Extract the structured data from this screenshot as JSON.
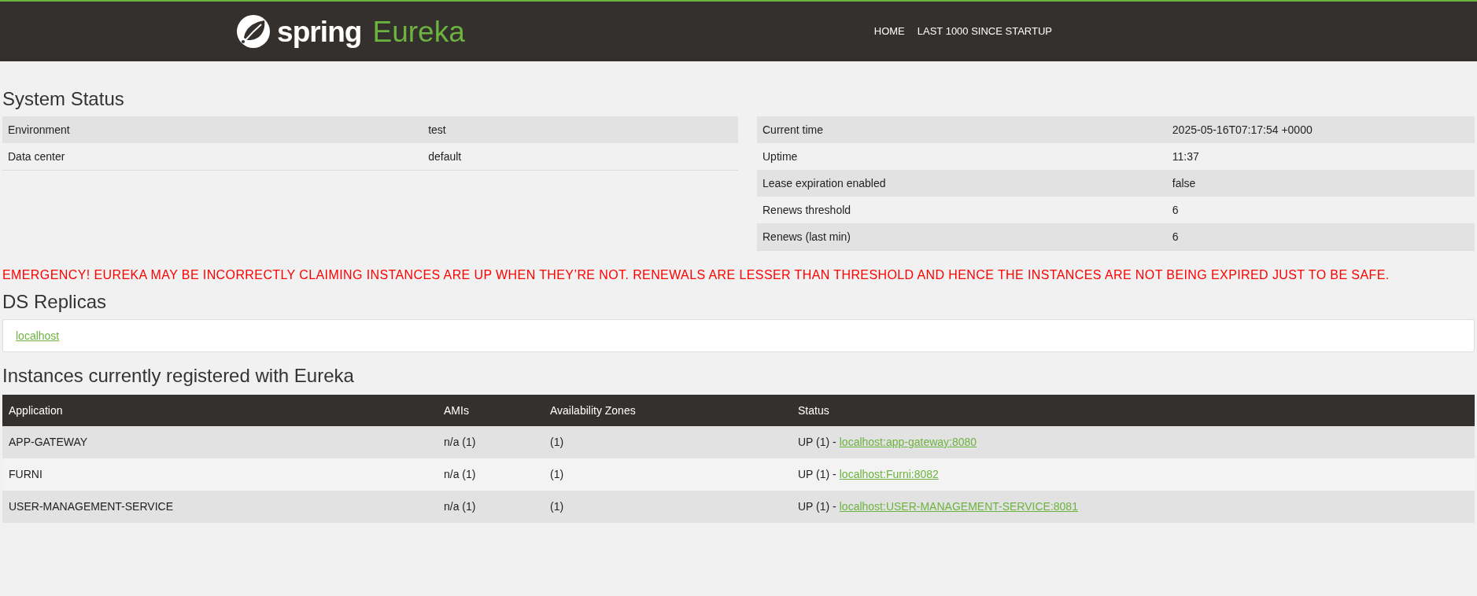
{
  "header": {
    "logo_word": "spring",
    "logo_product": "Eureka",
    "nav": [
      {
        "label": "HOME"
      },
      {
        "label": "LAST 1000 SINCE STARTUP"
      }
    ]
  },
  "system_status": {
    "title": "System Status",
    "left": [
      {
        "label": "Environment",
        "value": "test"
      },
      {
        "label": "Data center",
        "value": "default"
      }
    ],
    "right": [
      {
        "label": "Current time",
        "value": "2025-05-16T07:17:54 +0000"
      },
      {
        "label": "Uptime",
        "value": "11:37"
      },
      {
        "label": "Lease expiration enabled",
        "value": "false"
      },
      {
        "label": "Renews threshold",
        "value": "6"
      },
      {
        "label": "Renews (last min)",
        "value": "6"
      }
    ]
  },
  "emergency": "EMERGENCY! EUREKA MAY BE INCORRECTLY CLAIMING INSTANCES ARE UP WHEN THEY’RE NOT. RENEWALS ARE LESSER THAN THRESHOLD AND HENCE THE INSTANCES ARE NOT BEING EXPIRED JUST TO BE SAFE.",
  "ds_replicas": {
    "title": "DS Replicas",
    "items": [
      "localhost"
    ]
  },
  "instances": {
    "title": "Instances currently registered with Eureka",
    "columns": [
      "Application",
      "AMIs",
      "Availability Zones",
      "Status"
    ],
    "rows": [
      {
        "application": "APP-GATEWAY",
        "amis": "n/a (1)",
        "zones": "(1)",
        "status": "UP (1) -",
        "link": "localhost:app-gateway:8080"
      },
      {
        "application": "FURNI",
        "amis": "n/a (1)",
        "zones": "(1)",
        "status": "UP (1) -",
        "link": "localhost:Furni:8082"
      },
      {
        "application": "USER-MANAGEMENT-SERVICE",
        "amis": "n/a (1)",
        "zones": "(1)",
        "status": "UP (1) -",
        "link": "localhost:USER-MANAGEMENT-SERVICE:8081"
      }
    ]
  }
}
